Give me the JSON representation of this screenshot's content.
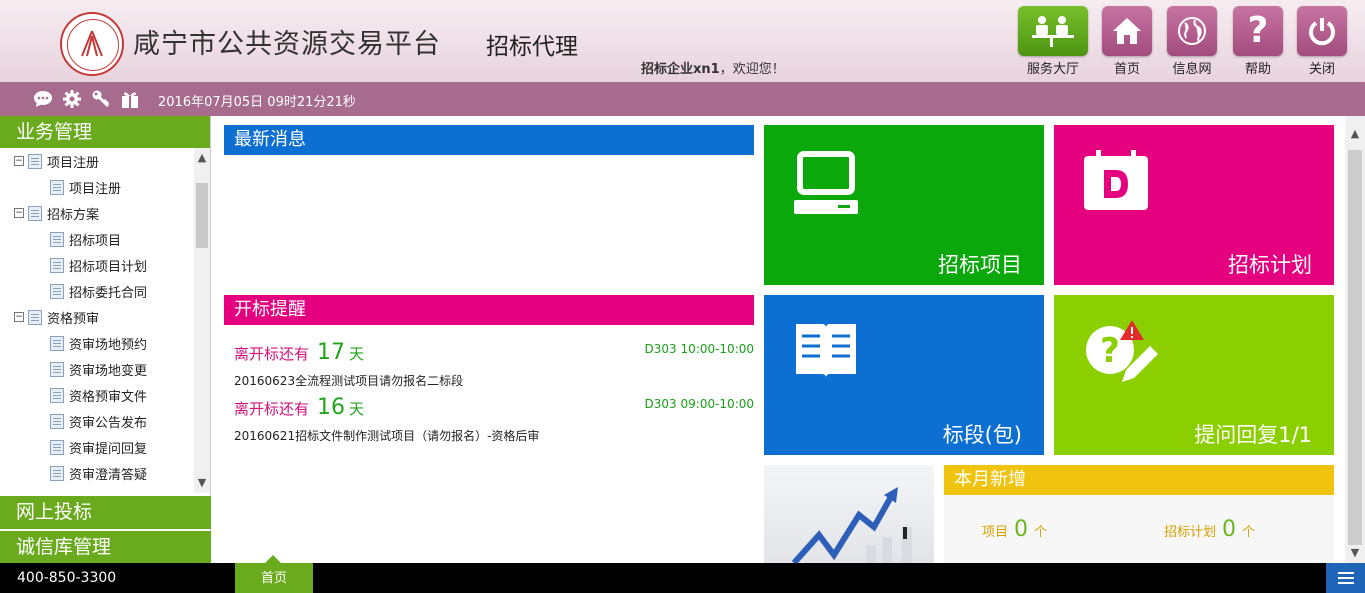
{
  "header": {
    "site_title": "咸宁市公共资源交易平台",
    "subtitle": "招标代理",
    "welcome_user": "招标企业xn1",
    "welcome_suffix": "，欢迎您！",
    "buttons": [
      {
        "label": "服务大厅",
        "icon": "service-hall-icon",
        "color": "#5aa41b"
      },
      {
        "label": "首页",
        "icon": "home-icon",
        "color": "#b85d91"
      },
      {
        "label": "信息网",
        "icon": "globe-icon",
        "color": "#b85d91"
      },
      {
        "label": "帮助",
        "icon": "help-icon",
        "color": "#b85d91"
      },
      {
        "label": "关闭",
        "icon": "power-icon",
        "color": "#b85d91"
      }
    ]
  },
  "toolbar": {
    "icons": [
      "chat-icon",
      "gear-icon",
      "key-icon",
      "gift-icon"
    ],
    "datetime": "2016年07月05日 09时21分21秒"
  },
  "sidebar": {
    "section_business": "业务管理",
    "tree": [
      {
        "label": "项目注册",
        "level": 1,
        "toggle": "⊟"
      },
      {
        "label": "项目注册",
        "level": 2
      },
      {
        "label": "招标方案",
        "level": 1,
        "toggle": "⊟"
      },
      {
        "label": "招标项目",
        "level": 2
      },
      {
        "label": "招标项目计划",
        "level": 2
      },
      {
        "label": "招标委托合同",
        "level": 2
      },
      {
        "label": "资格预审",
        "level": 1,
        "toggle": "⊟"
      },
      {
        "label": "资审场地预约",
        "level": 2
      },
      {
        "label": "资审场地变更",
        "level": 2
      },
      {
        "label": "资格预审文件",
        "level": 2
      },
      {
        "label": "资审公告发布",
        "level": 2
      },
      {
        "label": "资审提问回复",
        "level": 2
      },
      {
        "label": "资审澄清答疑",
        "level": 2
      }
    ],
    "section_online_bid": "网上投标",
    "section_credit": "诚信库管理"
  },
  "news": {
    "title": "最新消息"
  },
  "reminder": {
    "title": "开标提醒",
    "items": [
      {
        "prefix": "离开标还有",
        "days": "17",
        "unit": "天",
        "room": "D303 10:00-10:00",
        "project": "20160623全流程测试项目请勿报名二标段"
      },
      {
        "prefix": "离开标还有",
        "days": "16",
        "unit": "天",
        "room": "D303 09:00-10:00",
        "project": "20160621招标文件制作测试项目（请勿报名）-资格后审"
      }
    ]
  },
  "tiles": [
    {
      "label": "招标项目",
      "icon": "computer-icon",
      "color": "#0aa80a"
    },
    {
      "label": "招标计划",
      "icon": "calendar-icon",
      "color": "#e5007f"
    },
    {
      "label": "标段(包)",
      "icon": "book-icon",
      "color": "#0c6fd1"
    },
    {
      "label": "提问回复1/1",
      "icon": "question-edit-icon",
      "color": "#8ccf00"
    }
  ],
  "monthly": {
    "title": "本月新增",
    "stats": [
      {
        "label": "项目",
        "value": "0",
        "unit": "个"
      },
      {
        "label": "招标计划",
        "value": "0",
        "unit": "个"
      }
    ]
  },
  "footer": {
    "phone": "400-850-3300",
    "home_tab": "首页"
  }
}
